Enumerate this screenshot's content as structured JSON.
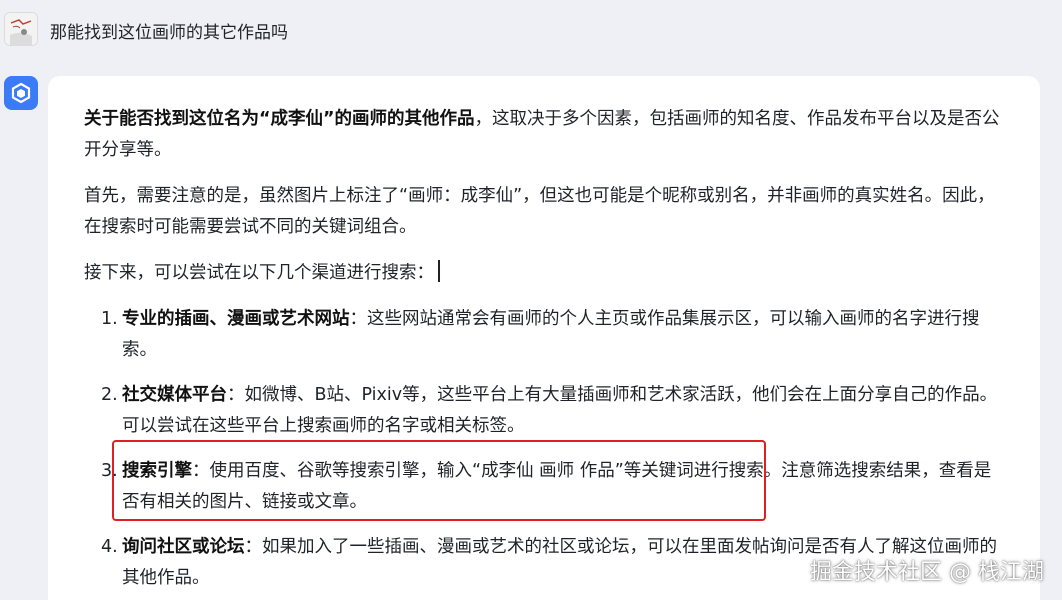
{
  "user": {
    "message": "那能找到这位画师的其它作品吗"
  },
  "assistant": {
    "para1_bold": "关于能否找到这位名为“成李仙”的画师的其他作品",
    "para1_rest": "，这取决于多个因素，包括画师的知名度、作品发布平台以及是否公开分享等。",
    "para2": "首先，需要注意的是，虽然图片上标注了“画师：成李仙”，但这也可能是个昵称或别名，并非画师的真实姓名。因此，在搜索时可能需要尝试不同的关键词组合。",
    "para3": "接下来，可以尝试在以下几个渠道进行搜索：",
    "list": [
      {
        "num": "1.",
        "title": "专业的插画、漫画或艺术网站",
        "text": "：这些网站通常会有画师的个人主页或作品集展示区，可以输入画师的名字进行搜索。"
      },
      {
        "num": "2.",
        "title": "社交媒体平台",
        "text": "：如微博、B站、Pixiv等，这些平台上有大量插画师和艺术家活跃，他们会在上面分享自己的作品。可以尝试在这些平台上搜索画师的名字或相关标签。"
      },
      {
        "num": "3.",
        "title": "搜索引擎",
        "text": "：使用百度、谷歌等搜索引擎，输入“成李仙 画师 作品”等关键词进行搜索。注意筛选搜索结果，查看是否有相关的图片、链接或文章。"
      },
      {
        "num": "4.",
        "title": "询问社区或论坛",
        "text": "：如果加入了一些插画、漫画或艺术的社区或论坛，可以在里面发帖询问是否有人了解这位画师的其他作品。"
      }
    ]
  },
  "watermark": "掘金技术社区 @ 栈江湖",
  "colors": {
    "background": "#eef0f5",
    "bubble": "#ffffff",
    "ai_avatar": "#3b7bf6",
    "highlight": "#e02020"
  }
}
